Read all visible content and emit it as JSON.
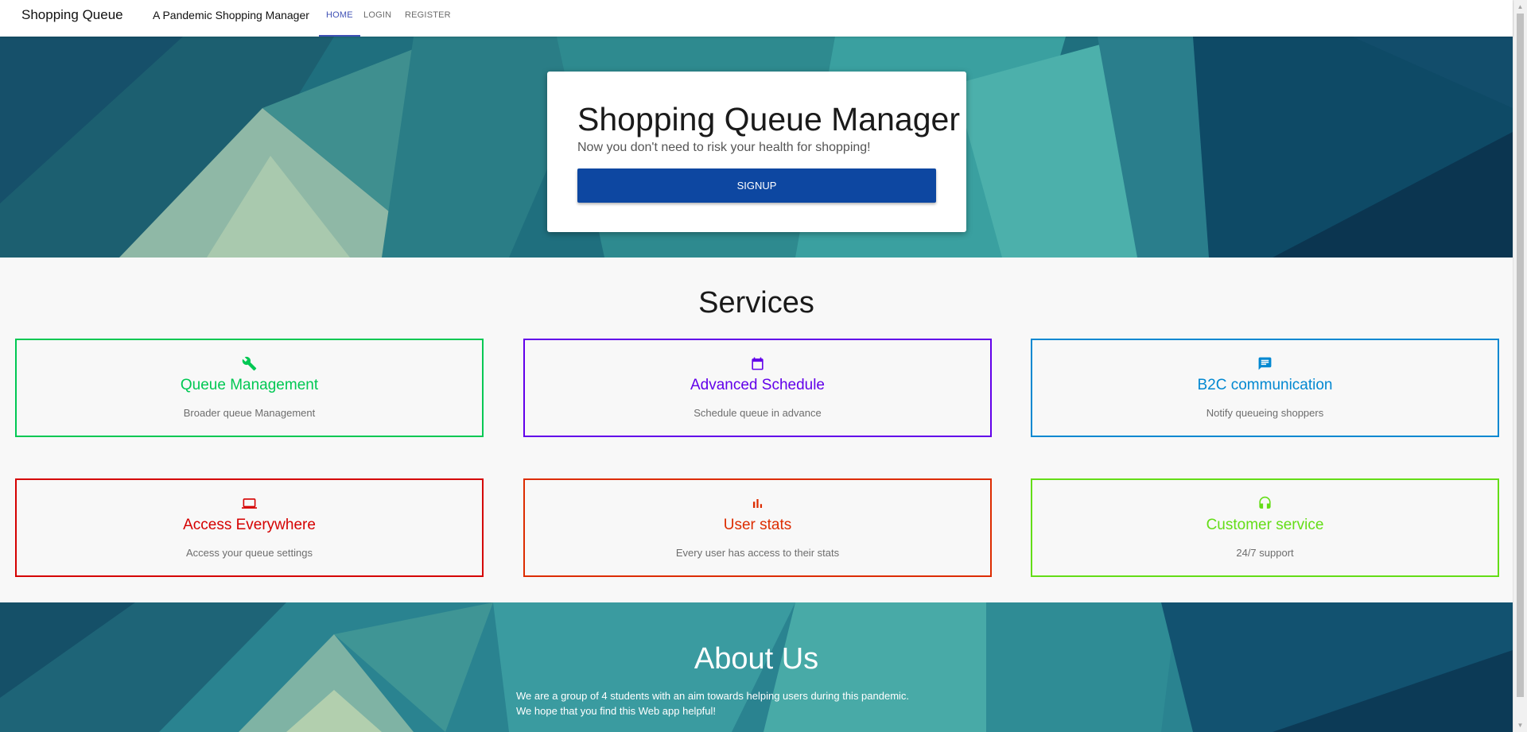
{
  "navbar": {
    "brand": "Shopping Queue",
    "tagline": "A Pandemic Shopping Manager",
    "items": [
      {
        "label": "HOME",
        "active": true
      },
      {
        "label": "LOGIN",
        "active": false
      },
      {
        "label": "REGISTER",
        "active": false
      }
    ]
  },
  "hero": {
    "title": "Shopping Queue Manager",
    "subtitle": "Now you don't need to risk your health for shopping!",
    "signup_label": "SIGNUP"
  },
  "services": {
    "title": "Services",
    "items": [
      {
        "icon": "wrench-icon",
        "title": "Queue Management",
        "description": "Broader queue Management",
        "color": "#00c853"
      },
      {
        "icon": "calendar-icon",
        "title": "Advanced Schedule",
        "description": "Schedule queue in advance",
        "color": "#6200ea"
      },
      {
        "icon": "chat-icon",
        "title": "B2C communication",
        "description": "Notify queueing shoppers",
        "color": "#0288d1"
      },
      {
        "icon": "laptop-icon",
        "title": "Access Everywhere",
        "description": "Access your queue settings",
        "color": "#d50000"
      },
      {
        "icon": "bar-chart-icon",
        "title": "User stats",
        "description": "Every user has access to their stats",
        "color": "#dd2c00"
      },
      {
        "icon": "headset-icon",
        "title": "Customer service",
        "description": "24/7 support",
        "color": "#64dd17"
      }
    ]
  },
  "about": {
    "title": "About Us",
    "lines": [
      "We are a group of 4 students with an aim towards helping users during this pandemic.",
      "We hope that you find this Web app helpful!"
    ]
  },
  "colors": {
    "nav_active": "#3f51b5",
    "signup_button": "#0d47a1"
  }
}
